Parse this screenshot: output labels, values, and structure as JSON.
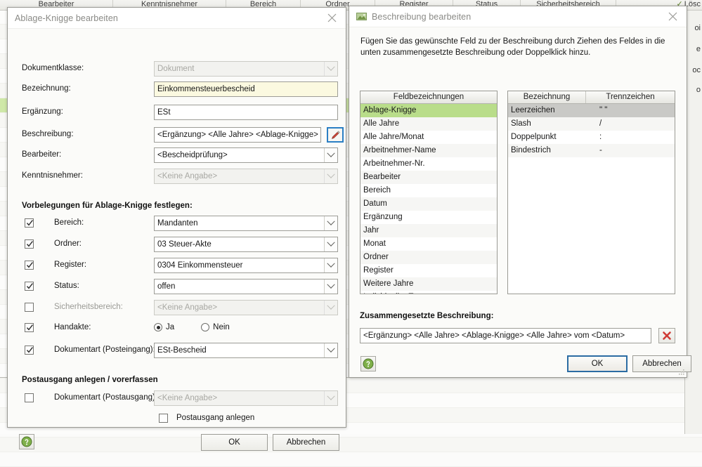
{
  "background": {
    "columns": [
      "Bearbeiter",
      "Kenntnisnehmer",
      "Bereich",
      "Ordner",
      "Register",
      "Status",
      "Sicherheitsbereich"
    ],
    "delete_label": "Lösc",
    "right_fragments": [
      "oi",
      "e",
      "oc",
      "o"
    ]
  },
  "dialog_left": {
    "title": "Ablage-Knigge bearbeiten",
    "close_label": "×",
    "fields": [
      {
        "label": "Dokumentklasse:",
        "value": "Dokument",
        "type": "combo",
        "disabled": true
      },
      {
        "label": "Bezeichnung:",
        "value": "Einkommensteuerbescheid",
        "type": "text",
        "highlight": true
      },
      {
        "label": "Ergänzung:",
        "value": "ESt",
        "type": "text"
      },
      {
        "label": "Beschreibung:",
        "value": "<Ergänzung> <Alle Jahre> <Ablage-Knigge> <Alle J.",
        "type": "text-with-button"
      },
      {
        "label": "Bearbeiter:",
        "value": "<Bescheidprüfung>",
        "type": "combo"
      },
      {
        "label": "Kenntnisnehmer:",
        "value": "<Keine Angabe>",
        "type": "combo",
        "disabled": true
      }
    ],
    "section_presets": "Vorbelegungen für Ablage-Knigge festlegen:",
    "presets": [
      {
        "label": "Bereich:",
        "value": "Mandanten",
        "checked": true,
        "type": "combo"
      },
      {
        "label": "Ordner:",
        "value": "03 Steuer-Akte",
        "checked": true,
        "type": "combo"
      },
      {
        "label": "Register:",
        "value": "0304 Einkommensteuer",
        "checked": true,
        "type": "combo"
      },
      {
        "label": "Status:",
        "value": "offen",
        "checked": true,
        "type": "combo"
      },
      {
        "label": "Sicherheitsbereich:",
        "value": "<Keine Angabe>",
        "checked": false,
        "type": "combo",
        "disabled": true
      },
      {
        "label": "Handakte:",
        "checked": true,
        "type": "radio",
        "options": [
          "Ja",
          "Nein"
        ],
        "selected": "Ja"
      },
      {
        "label": "Dokumentart (Posteingang):",
        "value": "ESt-Bescheid",
        "checked": true,
        "type": "combo"
      }
    ],
    "section_outbox": "Postausgang anlegen / vorerfassen",
    "outbox": {
      "label": "Dokumentart (Postausgang):",
      "value": "<Keine Angabe>",
      "checked": false,
      "create_label": "Postausgang anlegen",
      "create_checked": false
    },
    "buttons": {
      "help": "?",
      "ok": "OK",
      "cancel": "Abbrechen"
    }
  },
  "dialog_right": {
    "title": "Beschreibung bearbeiten",
    "close_label": "×",
    "instruction": "Fügen Sie das gewünschte Feld zu der Beschreibung durch Ziehen des Feldes in die unten zusammengesetzte Beschreibung oder Doppelklick hinzu.",
    "field_list": {
      "header": "Feldbezeichnungen",
      "items": [
        "Ablage-Knigge",
        "Alle Jahre",
        "Alle Jahre/Monat",
        "Arbeitnehmer-Name",
        "Arbeitnehmer-Nr.",
        "Bearbeiter",
        "Bereich",
        "Datum",
        "Ergänzung",
        "Jahr",
        "Monat",
        "Ordner",
        "Register",
        "Weitere Jahre",
        "Individueller Text ..."
      ],
      "selected_index": 0
    },
    "separator_list": {
      "headers": [
        "Bezeichnung",
        "Trennzeichen"
      ],
      "rows": [
        {
          "name": "Leerzeichen",
          "char": "\" \""
        },
        {
          "name": "Slash",
          "char": "/"
        },
        {
          "name": "Doppelpunkt",
          "char": ":"
        },
        {
          "name": "Bindestrich",
          "char": "-"
        }
      ],
      "selected_index": 0
    },
    "composite_label": "Zusammengesetzte Beschreibung:",
    "composite_value": "<Ergänzung> <Alle Jahre> <Ablage-Knigge> <Alle Jahre> vom <Datum>",
    "buttons": {
      "help": "?",
      "clear": "×",
      "ok": "OK",
      "cancel": "Abbrechen"
    }
  },
  "colors": {
    "accent_blue": "#2b7fc4",
    "selection_green": "#b9dd8a",
    "selection_gray": "#c9c9c6",
    "highlight_yellow": "#fbf9e0",
    "delete_red": "#cf3b36"
  }
}
